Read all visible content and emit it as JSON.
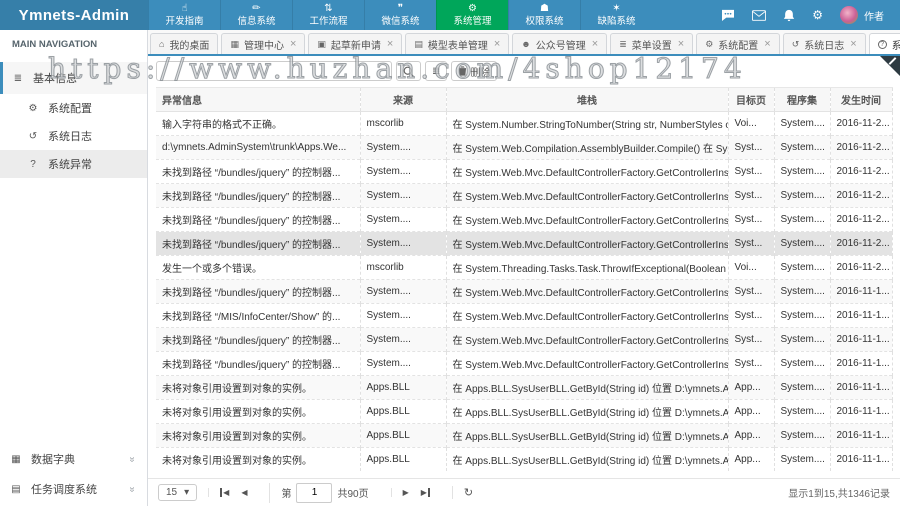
{
  "navbar": {
    "brand": "Ymnets-Admin",
    "user_name": "作者",
    "menu": [
      {
        "label": "开发指南",
        "icon": "hand-icon",
        "active": false
      },
      {
        "label": "信息系统",
        "icon": "pencil-icon",
        "active": false
      },
      {
        "label": "工作流程",
        "icon": "flow-icon",
        "active": false
      },
      {
        "label": "微信系统",
        "icon": "comments-icon",
        "active": false
      },
      {
        "label": "系统管理",
        "icon": "cogs-icon",
        "active": true
      },
      {
        "label": "权限系统",
        "icon": "shield-icon",
        "active": false
      },
      {
        "label": "缺陷系统",
        "icon": "bug-icon",
        "active": false
      }
    ]
  },
  "tabs": [
    {
      "label": "我的桌面",
      "icon": "home-icon",
      "closable": false,
      "active": false
    },
    {
      "label": "管理中心",
      "icon": "bank-icon",
      "closable": true,
      "active": false
    },
    {
      "label": "起草新申请",
      "icon": "calendar-icon",
      "closable": true,
      "active": false
    },
    {
      "label": "模型表单管理",
      "icon": "book-icon",
      "closable": true,
      "active": false
    },
    {
      "label": "公众号管理",
      "icon": "users-icon",
      "closable": true,
      "active": false
    },
    {
      "label": "菜单设置",
      "icon": "list-icon",
      "closable": true,
      "active": false
    },
    {
      "label": "系统配置",
      "icon": "gear-icon",
      "closable": true,
      "active": false
    },
    {
      "label": "系统日志",
      "icon": "history-icon",
      "closable": true,
      "active": false
    },
    {
      "label": "系统异常",
      "icon": "question-icon",
      "closable": true,
      "active": true
    }
  ],
  "sidebar": {
    "header": "MAIN NAVIGATION",
    "group": {
      "label": "基本信息",
      "icon": "list-icon"
    },
    "items": [
      {
        "label": "系统配置",
        "icon": "cogs-icon",
        "selected": false
      },
      {
        "label": "系统日志",
        "icon": "history-icon",
        "selected": false
      },
      {
        "label": "系统异常",
        "icon": "question-icon",
        "selected": true
      }
    ],
    "bottom_items": [
      {
        "label": "数据字典",
        "icon": "table-icon"
      },
      {
        "label": "任务调度系统",
        "icon": "tasks-icon"
      }
    ]
  },
  "toolbar": {
    "search_value": "",
    "delete_label": "删除"
  },
  "table": {
    "columns": [
      "异常信息",
      "来源",
      "堆栈",
      "目标页",
      "程序集",
      "发生时间"
    ],
    "rows": [
      {
        "message": "输入字符串的格式不正确。",
        "source": "mscorlib",
        "stack": "在 System.Number.StringToNumber(String str, NumberStyles options, NumberBuffer& numbe...",
        "target": "Voi...",
        "assembly": "System....",
        "time": "2016-11-2...",
        "selected": false
      },
      {
        "message": "d:\\ymnets.AdminSystem\\trunk\\Apps.We...",
        "source": "System....",
        "stack": "在 System.Web.Compilation.AssemblyBuilder.Compile() 在 System.Web.Compilation.BuildProvi...",
        "target": "Syst...",
        "assembly": "System....",
        "time": "2016-11-2...",
        "selected": false
      },
      {
        "message": "未找到路径 “/bundles/jquery” 的控制器...",
        "source": "System....",
        "stack": "在 System.Web.Mvc.DefaultControllerFactory.GetControllerInstance(RequestContext requestCo...",
        "target": "Syst...",
        "assembly": "System....",
        "time": "2016-11-2...",
        "selected": false
      },
      {
        "message": "未找到路径 “/bundles/jquery” 的控制器...",
        "source": "System....",
        "stack": "在 System.Web.Mvc.DefaultControllerFactory.GetControllerInstance(RequestContext requestCo...",
        "target": "Syst...",
        "assembly": "System....",
        "time": "2016-11-2...",
        "selected": false
      },
      {
        "message": "未找到路径 “/bundles/jquery” 的控制器...",
        "source": "System....",
        "stack": "在 System.Web.Mvc.DefaultControllerFactory.GetControllerInstance(RequestContext requestCo...",
        "target": "Syst...",
        "assembly": "System....",
        "time": "2016-11-2...",
        "selected": false
      },
      {
        "message": "未找到路径 “/bundles/jquery” 的控制器...",
        "source": "System....",
        "stack": "在 System.Web.Mvc.DefaultControllerFactory.GetControllerInstance(RequestContext requestCo...",
        "target": "Syst...",
        "assembly": "System....",
        "time": "2016-11-2...",
        "selected": true
      },
      {
        "message": "发生一个或多个错误。",
        "source": "mscorlib",
        "stack": "在 System.Threading.Tasks.Task.ThrowIfExceptional(Boolean includeTaskCanceledExceptions) ...",
        "target": "Voi...",
        "assembly": "System....",
        "time": "2016-11-2...",
        "selected": false
      },
      {
        "message": "未找到路径 “/bundles/jquery” 的控制器...",
        "source": "System....",
        "stack": "在 System.Web.Mvc.DefaultControllerFactory.GetControllerInstance(RequestContext requestCo...",
        "target": "Syst...",
        "assembly": "System....",
        "time": "2016-11-1...",
        "selected": false
      },
      {
        "message": "未找到路径 “/MIS/InfoCenter/Show” 的...",
        "source": "System....",
        "stack": "在 System.Web.Mvc.DefaultControllerFactory.GetControllerInstance(RequestContext requestCo...",
        "target": "Syst...",
        "assembly": "System....",
        "time": "2016-11-1...",
        "selected": false
      },
      {
        "message": "未找到路径 “/bundles/jquery” 的控制器...",
        "source": "System....",
        "stack": "在 System.Web.Mvc.DefaultControllerFactory.GetControllerInstance(RequestContext requestCo...",
        "target": "Syst...",
        "assembly": "System....",
        "time": "2016-11-1...",
        "selected": false
      },
      {
        "message": "未找到路径 “/bundles/jquery” 的控制器...",
        "source": "System....",
        "stack": "在 System.Web.Mvc.DefaultControllerFactory.GetControllerInstance(RequestContext requestCo...",
        "target": "Syst...",
        "assembly": "System....",
        "time": "2016-11-1...",
        "selected": false
      },
      {
        "message": "未将对象引用设置到对象的实例。",
        "source": "Apps.BLL",
        "stack": "在 Apps.BLL.SysUserBLL.GetById(String id) 位置 D:\\ymnets.AdminSystem\\trunk\\Apps.BLL\\SysUs...",
        "target": "App...",
        "assembly": "System....",
        "time": "2016-11-1...",
        "selected": false
      },
      {
        "message": "未将对象引用设置到对象的实例。",
        "source": "Apps.BLL",
        "stack": "在 Apps.BLL.SysUserBLL.GetById(String id) 位置 D:\\ymnets.AdminSystem\\trunk\\Apps.BLL\\SysUs...",
        "target": "App...",
        "assembly": "System....",
        "time": "2016-11-1...",
        "selected": false
      },
      {
        "message": "未将对象引用设置到对象的实例。",
        "source": "Apps.BLL",
        "stack": "在 Apps.BLL.SysUserBLL.GetById(String id) 位置 D:\\ymnets.AdminSystem\\trunk\\Apps.BLL\\SysUs...",
        "target": "App...",
        "assembly": "System....",
        "time": "2016-11-1...",
        "selected": false
      },
      {
        "message": "未将对象引用设置到对象的实例。",
        "source": "Apps.BLL",
        "stack": "在 Apps.BLL.SysUserBLL.GetById(String id) 位置 D:\\ymnets.AdminSystem\\trunk\\Apps.BLL\\SysUs...",
        "target": "App...",
        "assembly": "System....",
        "time": "2016-11-1...",
        "selected": false
      }
    ]
  },
  "pagination": {
    "page_size": "15",
    "page_prefix": "第",
    "page_value": "1",
    "total_pages": "共90页",
    "summary": "显示1到15,共1346记录"
  },
  "watermark": "https://www.huzhan.com/4shop12174",
  "colors": {
    "navbar": "#3c8dbc",
    "brand": "#367fa9",
    "active_menu": "#00a65a"
  }
}
